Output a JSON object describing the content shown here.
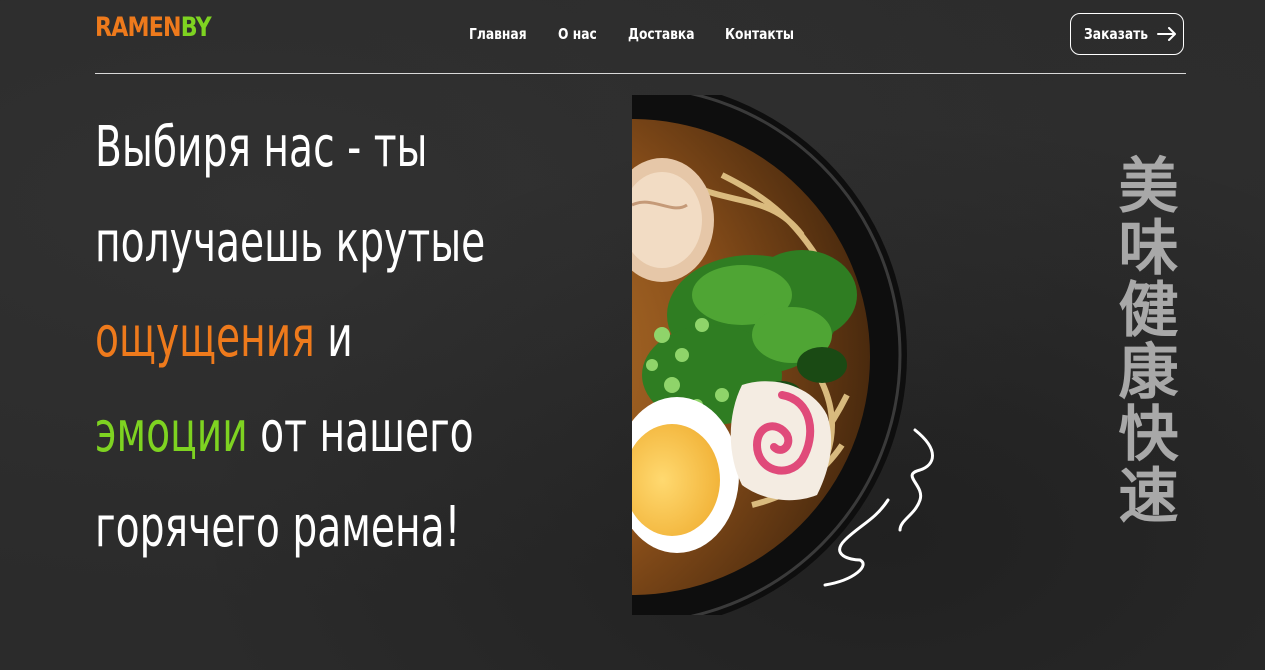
{
  "header": {
    "logo_part1": "RAMEN",
    "logo_part2": "BY",
    "nav": [
      "Главная",
      "О нас",
      "Доставка",
      "Контакты"
    ],
    "order_label": "Заказать"
  },
  "hero": {
    "line1": "Выбиря нас - ты",
    "line2": "получаешь крутые",
    "line3_accent": "ощущения",
    "line3_rest": " и",
    "line4_accent": "эмоции",
    "line4_rest": " от нашего",
    "line5": "горячего рамена!",
    "vertical_text": "美味健康快速",
    "image_icon": "ramen-bowl-icon"
  },
  "colors": {
    "orange": "#ee7a1c",
    "green": "#7ed321",
    "background": "#2b2b2b",
    "vertical_text": "#a8a8a8"
  }
}
